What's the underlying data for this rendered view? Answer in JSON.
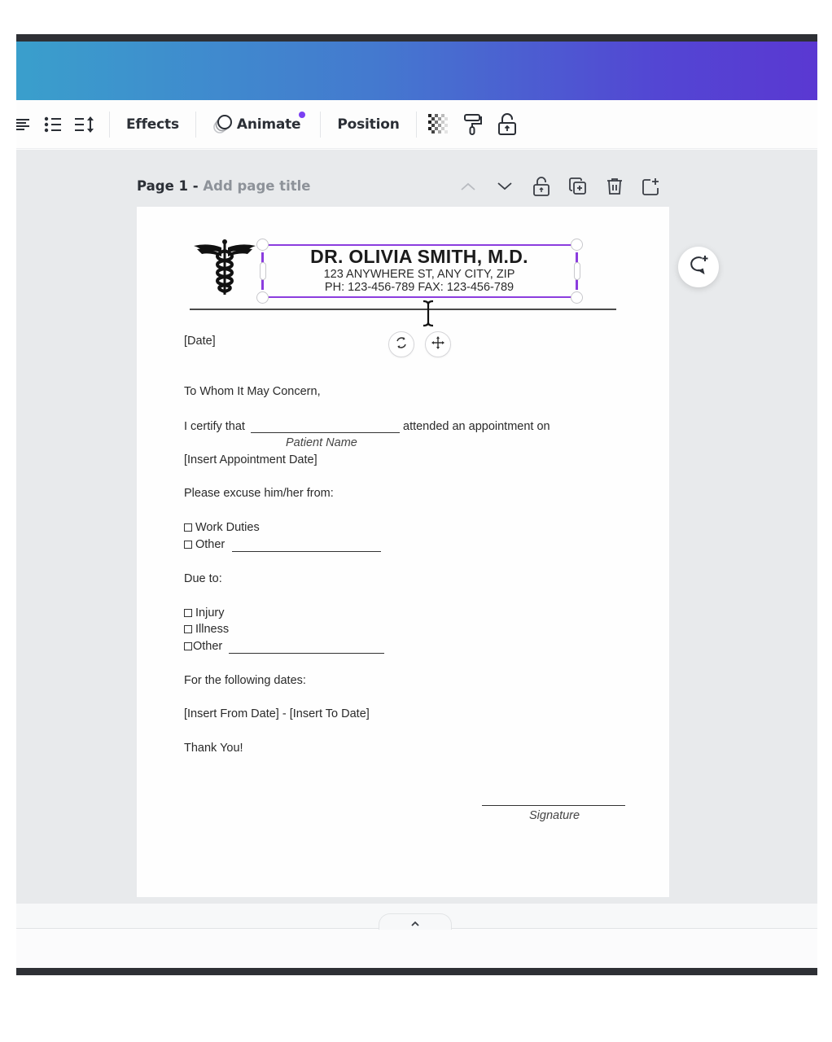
{
  "toolbar": {
    "effects_label": "Effects",
    "animate_label": "Animate",
    "position_label": "Position",
    "icons": [
      "align-left-icon",
      "bulleted-list-icon",
      "line-spacing-icon",
      "transparency-icon",
      "paint-roller-icon",
      "unlock-icon"
    ]
  },
  "page_header": {
    "page_label": "Page 1",
    "separator": " - ",
    "add_title_placeholder": "Add page title",
    "actions": [
      "chevron-up-icon",
      "chevron-down-icon",
      "lock-icon",
      "duplicate-page-icon",
      "trash-icon",
      "add-page-icon"
    ]
  },
  "document": {
    "header": {
      "name": "DR. OLIVIA SMITH, M.D.",
      "address": "123 ANYWHERE ST, ANY CITY, ZIP",
      "phone": "PH: 123-456-789 FAX: 123-456-789"
    },
    "date": "[Date]",
    "salutation": "To Whom It May Concern,",
    "certify_prefix": "I certify that",
    "certify_suffix": "attended an appointment on",
    "patient_name_caption": "Patient Name",
    "appointment_date": "[Insert Appointment Date]",
    "excuse_heading": "Please excuse him/her from:",
    "excuse_options": [
      "Work Duties",
      "Other"
    ],
    "due_heading": "Due to:",
    "due_options": [
      "Injury",
      "Illness",
      "Other"
    ],
    "dates_heading": "For the following dates:",
    "date_range": "[Insert From Date] - [Insert To Date]",
    "closing": "Thank You!",
    "signature_caption": "Signature"
  },
  "selection": {
    "accent_color": "#8b3dde"
  },
  "colors": {
    "header_gradient_start": "#3a9fcc",
    "header_gradient_end": "#5a38d2",
    "animate_badge": "#7b3ff2",
    "workspace_bg": "#e8eaec"
  }
}
